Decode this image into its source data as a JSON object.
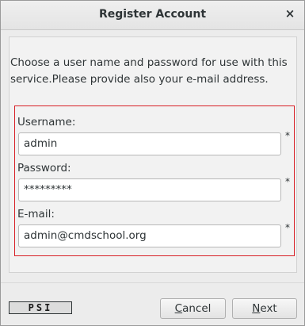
{
  "window": {
    "title": "Register Account",
    "close_glyph": "×"
  },
  "description": "Choose a user name and password for use with this service.Please provide also your e-mail address.",
  "form": {
    "border_color": "#d81f26",
    "fields": [
      {
        "label": "Username:",
        "value": "admin",
        "required_mark": "*"
      },
      {
        "label": "Password:",
        "value": "*********",
        "required_mark": "*"
      },
      {
        "label": "E-mail:",
        "value": "admin@cmdschool.org",
        "required_mark": "*"
      }
    ]
  },
  "footer": {
    "logo_text": "PSI",
    "cancel": {
      "mnemonic": "C",
      "rest": "ancel"
    },
    "next": {
      "mnemonic": "N",
      "rest": "ext"
    }
  }
}
